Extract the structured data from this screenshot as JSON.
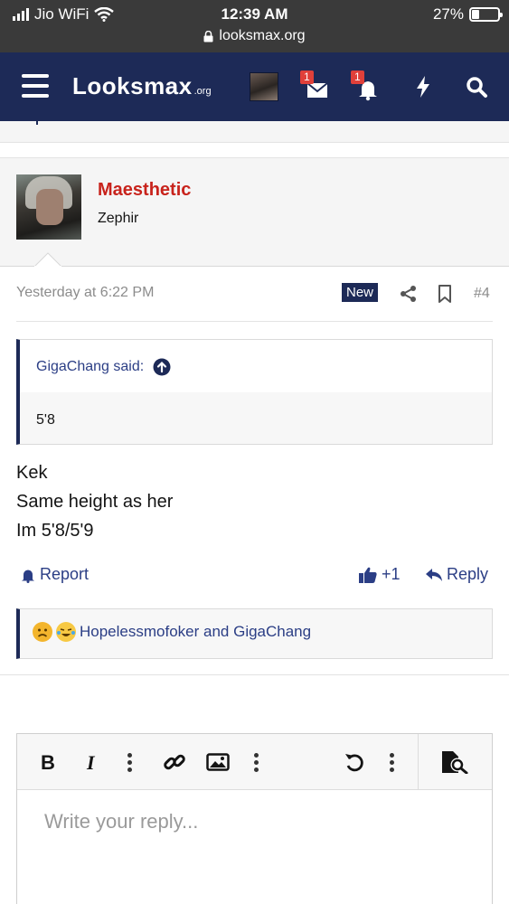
{
  "status_bar": {
    "carrier": "Jio WiFi",
    "time": "12:39 AM",
    "url": "looksmax.org",
    "battery": "27%",
    "battery_level": 0.27
  },
  "nav": {
    "logo": "Looksmax",
    "logo_suffix": ".org",
    "conversations_badge": "1",
    "alerts_badge": "1",
    "icons": [
      "menu-icon",
      "avatar",
      "envelope-icon",
      "bell-icon",
      "bolt-icon",
      "search-icon"
    ]
  },
  "post": {
    "author": "Maesthetic",
    "author_title": "Zephir",
    "timestamp": "Yesterday at 6:22 PM",
    "new_label": "New",
    "post_number": "#4",
    "quote": {
      "author_label": "GigaChang said:",
      "text": "5'8"
    },
    "body_lines": [
      "Kek",
      "Same height as her",
      "Im 5'8/5'9"
    ],
    "actions": {
      "report": "Report",
      "like": "+1",
      "reply": "Reply"
    },
    "reactions_text": "Hopelessmofoker and GigaChang"
  },
  "editor": {
    "placeholder": "Write your reply...",
    "toolbar_icons": [
      "bold-icon",
      "italic-icon",
      "more-icon",
      "link-icon",
      "image-icon",
      "more-icon",
      "undo-icon",
      "more-icon",
      "preview-icon"
    ]
  },
  "colors": {
    "nav_bg": "#1d2a57",
    "username": "#c8231c",
    "link": "#2b3e85",
    "badge": "#e0403a"
  }
}
